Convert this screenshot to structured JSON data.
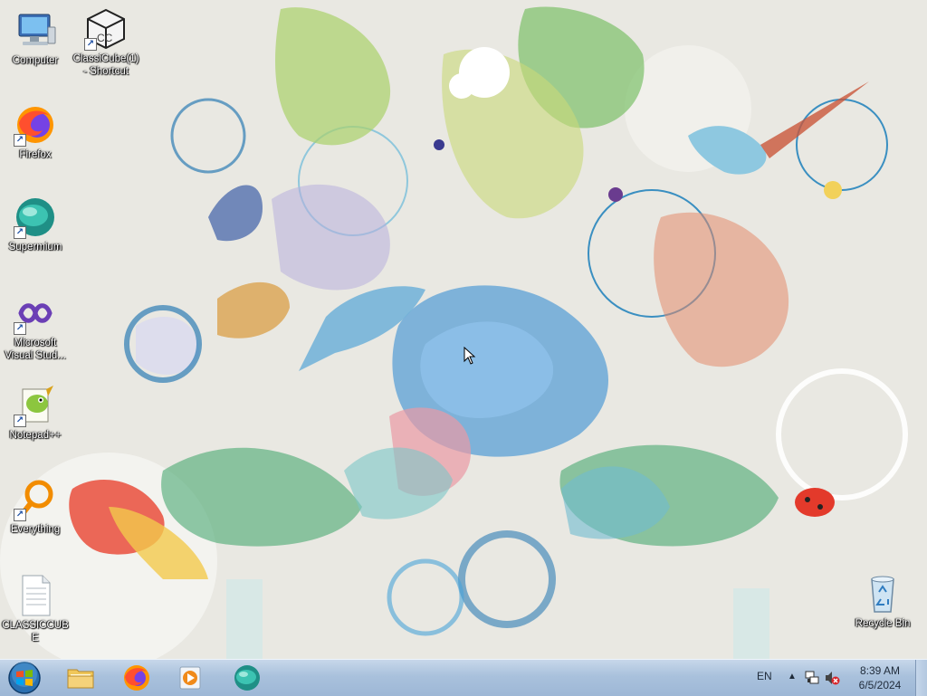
{
  "desktop": {
    "icons": [
      {
        "label": "Computer",
        "icon": "computer-icon",
        "shortcut": false
      },
      {
        "label": "ClassiCube(1) - Shortcut",
        "icon": "classicube-icon",
        "shortcut": true
      },
      {
        "label": "Firefox",
        "icon": "firefox-icon",
        "shortcut": true
      },
      {
        "label": "Supermium",
        "icon": "supermium-icon",
        "shortcut": true
      },
      {
        "label": "Microsoft Visual Stud...",
        "icon": "visual-studio-icon",
        "shortcut": true
      },
      {
        "label": "Notepad++",
        "icon": "notepad-plus-plus-icon",
        "shortcut": true
      },
      {
        "label": "Everything",
        "icon": "everything-search-icon",
        "shortcut": true
      },
      {
        "label": "CLASSICCUBE",
        "icon": "text-file-icon",
        "shortcut": false
      },
      {
        "label": "Recycle Bin",
        "icon": "recycle-bin-icon",
        "shortcut": false
      }
    ]
  },
  "taskbar": {
    "start": "windows-orb-icon",
    "pinned": [
      {
        "name": "file-explorer",
        "icon": "folder-icon"
      },
      {
        "name": "firefox",
        "icon": "firefox-icon"
      },
      {
        "name": "media-player",
        "icon": "media-player-icon"
      },
      {
        "name": "supermium",
        "icon": "supermium-icon"
      }
    ],
    "tray": {
      "language": "EN",
      "show_hidden": "▲",
      "time": "8:39 AM",
      "date": "6/5/2024"
    }
  },
  "colors": {
    "taskbar_top": "#c7d7ea",
    "taskbar_bottom": "#9db7d6",
    "desktop_bg": "#e9e8e2"
  }
}
